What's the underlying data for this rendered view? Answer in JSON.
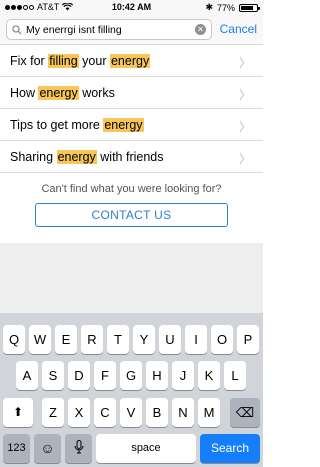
{
  "status": {
    "carrier": "AT&T",
    "time": "10:42 AM",
    "battery": "77%",
    "battery_level": 0.77
  },
  "search": {
    "query": "My enerrgi isnt filling",
    "cancel_label": "Cancel",
    "clear_label": "✕"
  },
  "results": [
    {
      "pre": "Fix for ",
      "hl1": "filling",
      "mid": " your ",
      "hl2": "energy",
      "post": ""
    },
    {
      "pre": "How ",
      "hl1": "energy",
      "mid": " works",
      "hl2": "",
      "post": ""
    },
    {
      "pre": "Tips to get more ",
      "hl1": "energy",
      "mid": "",
      "hl2": "",
      "post": ""
    },
    {
      "pre": "Sharing ",
      "hl1": "energy",
      "mid": " with friends",
      "hl2": "",
      "post": ""
    }
  ],
  "help": {
    "prompt": "Can't find what you were looking for?",
    "contact_label": "CONTACT US"
  },
  "keyboard": {
    "row1": [
      "Q",
      "W",
      "E",
      "R",
      "T",
      "Y",
      "U",
      "I",
      "O",
      "P"
    ],
    "row2": [
      "A",
      "S",
      "D",
      "F",
      "G",
      "H",
      "J",
      "K",
      "L"
    ],
    "row3": [
      "Z",
      "X",
      "C",
      "V",
      "B",
      "N",
      "M"
    ],
    "shift": "⬆",
    "backspace": "⌫",
    "numbers": "123",
    "emoji": "☺",
    "mic": "🎤",
    "space": "space",
    "search": "Search"
  },
  "colors": {
    "accent": "#1a7cf2",
    "highlight": "#f6c65a",
    "search_key": "#157efb"
  }
}
